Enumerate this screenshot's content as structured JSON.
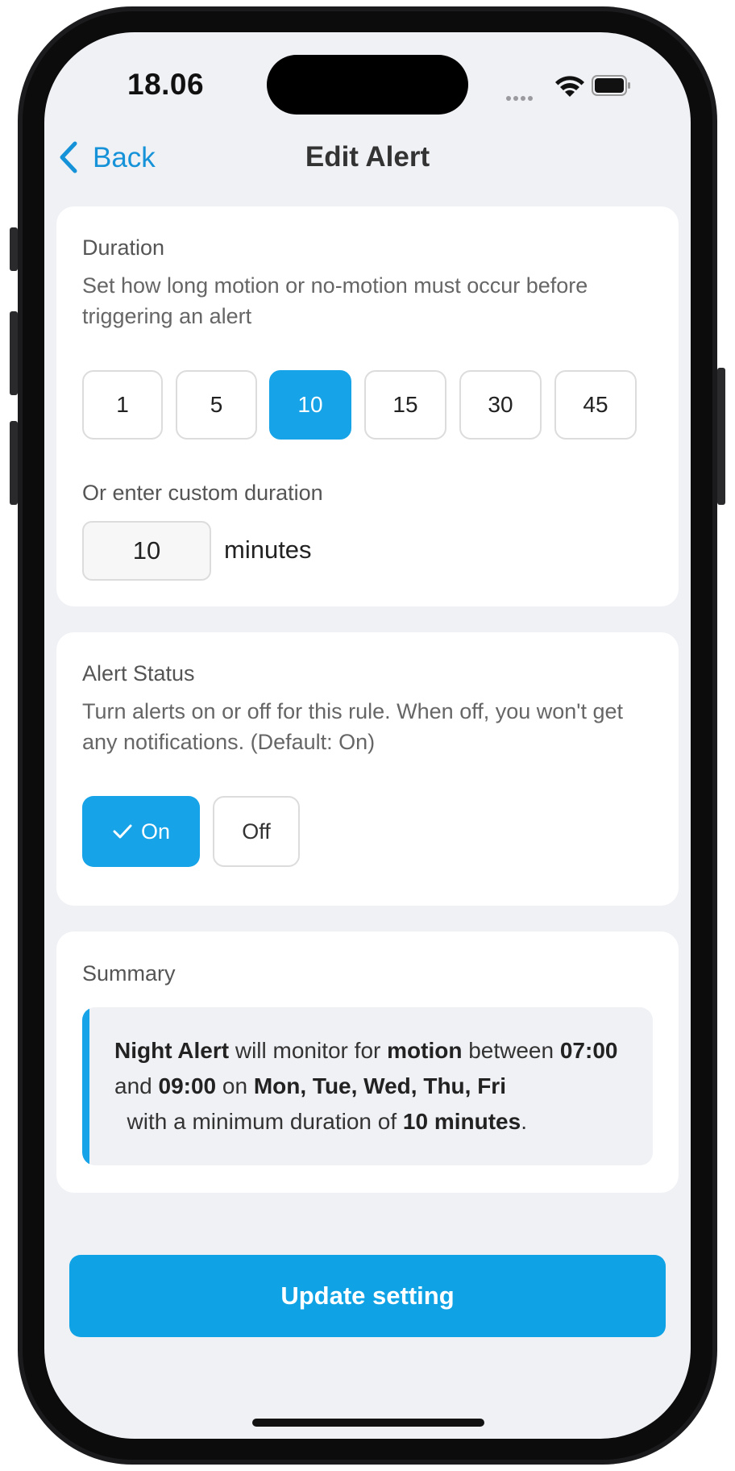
{
  "status_bar": {
    "time": "18.06"
  },
  "nav": {
    "back_label": "Back",
    "title": "Edit Alert"
  },
  "duration": {
    "heading": "Duration",
    "description": "Set how long motion or no-motion must occur before triggering an alert",
    "options": [
      "1",
      "5",
      "10",
      "15",
      "30",
      "45"
    ],
    "selected": "10",
    "custom_label": "Or enter custom duration",
    "custom_value": "10",
    "unit": "minutes"
  },
  "alert_status": {
    "heading": "Alert Status",
    "description": "Turn alerts on or off for this rule. When off, you won't get any notifications. (Default: On)",
    "on_label": "On",
    "off_label": "Off",
    "selected": "On"
  },
  "summary": {
    "heading": "Summary",
    "alert_name": "Night Alert",
    "t1": " will monitor for ",
    "trigger": "motion",
    "t2": " between ",
    "start_time": "07:00",
    "t3": " and ",
    "end_time": "09:00",
    "t4": " on ",
    "days": "Mon, Tue, Wed, Thu, Fri",
    "t5": "  with a minimum duration of ",
    "min_duration": "10 minutes",
    "t6": "."
  },
  "cta": {
    "label": "Update setting"
  },
  "colors": {
    "accent": "#16a3e8",
    "background": "#f0f1f5",
    "card": "#ffffff"
  },
  "icons": [
    "wifi-icon",
    "battery-icon",
    "back-chevron-icon",
    "checkmark-icon"
  ]
}
